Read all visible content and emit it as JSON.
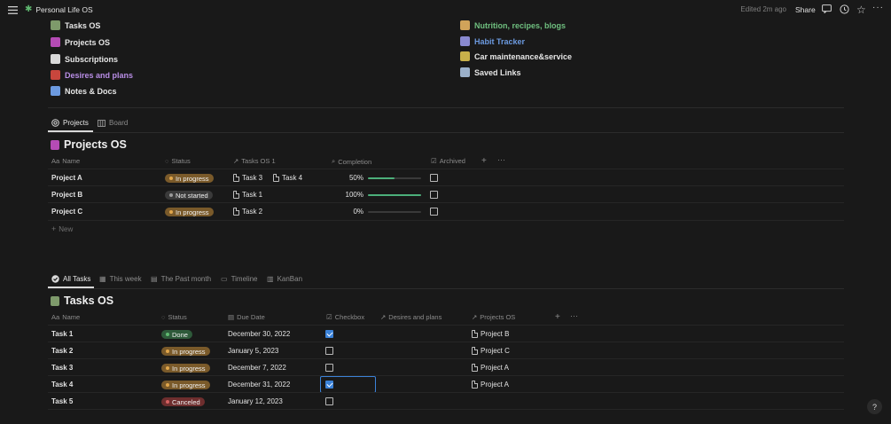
{
  "topbar": {
    "title": "Personal Life OS",
    "edited": "Edited 2m ago",
    "share": "Share"
  },
  "links_left": [
    {
      "label": "Tasks OS",
      "icon": "tasks-icon",
      "color": "#e6e6e6"
    },
    {
      "label": "Projects OS",
      "icon": "projects-icon",
      "color": "#e6e6e6"
    },
    {
      "label": "Subscriptions",
      "icon": "subscriptions-icon",
      "color": "#e6e6e6"
    },
    {
      "label": "Desires and plans",
      "icon": "calendar-icon",
      "color": "#b98ee6"
    },
    {
      "label": "Notes & Docs",
      "icon": "notes-icon",
      "color": "#e6e6e6"
    }
  ],
  "links_right": [
    {
      "label": "Nutrition, recipes, blogs",
      "icon": "nutrition-icon",
      "color": "#6fbf7f"
    },
    {
      "label": "Habit Tracker",
      "icon": "habit-icon",
      "color": "#6c9ae0"
    },
    {
      "label": "Car maintenance&service",
      "icon": "car-icon",
      "color": "#e6e6e6"
    },
    {
      "label": "Saved Links",
      "icon": "floppy-icon",
      "color": "#e6e6e6"
    }
  ],
  "projects": {
    "tabs": [
      "Projects",
      "Board"
    ],
    "title": "Projects OS",
    "headers": {
      "name": "Name",
      "status": "Status",
      "tasks": "Tasks OS 1",
      "completion": "Completion",
      "archived": "Archived"
    },
    "rows": [
      {
        "name": "Project A",
        "status": "In progress",
        "status_kind": "progress",
        "tasks": [
          "Task 3",
          "Task 4"
        ],
        "completion": "50%",
        "fill": 0.5,
        "archived": false
      },
      {
        "name": "Project B",
        "status": "Not started",
        "status_kind": "notstarted",
        "tasks": [
          "Task 1"
        ],
        "completion": "100%",
        "fill": 1.0,
        "archived": false
      },
      {
        "name": "Project C",
        "status": "In progress",
        "status_kind": "progress",
        "tasks": [
          "Task 2"
        ],
        "completion": "0%",
        "fill": 0.0,
        "archived": false
      }
    ],
    "new_label": "New"
  },
  "tasks": {
    "tabs": [
      "All Tasks",
      "This week",
      "The Past month",
      "Timeline",
      "KanBan"
    ],
    "title": "Tasks OS",
    "headers": {
      "name": "Name",
      "status": "Status",
      "due": "Due Date",
      "checkbox": "Checkbox",
      "desires": "Desires and plans",
      "projects": "Projects OS"
    },
    "rows": [
      {
        "name": "Task 1",
        "status": "Done",
        "status_kind": "done",
        "due": "December 30, 2022",
        "checked": true,
        "project": "Project B"
      },
      {
        "name": "Task 2",
        "status": "In progress",
        "status_kind": "progress",
        "due": "January 5, 2023",
        "checked": false,
        "project": "Project C"
      },
      {
        "name": "Task 3",
        "status": "In progress",
        "status_kind": "progress",
        "due": "December 7, 2022",
        "checked": false,
        "project": "Project A"
      },
      {
        "name": "Task 4",
        "status": "In progress",
        "status_kind": "progress",
        "due": "December 31, 2022",
        "checked": true,
        "project": "Project A"
      },
      {
        "name": "Task 5",
        "status": "Canceled",
        "status_kind": "canceled",
        "due": "January 12, 2023",
        "checked": false,
        "project": ""
      }
    ]
  },
  "help": "?"
}
